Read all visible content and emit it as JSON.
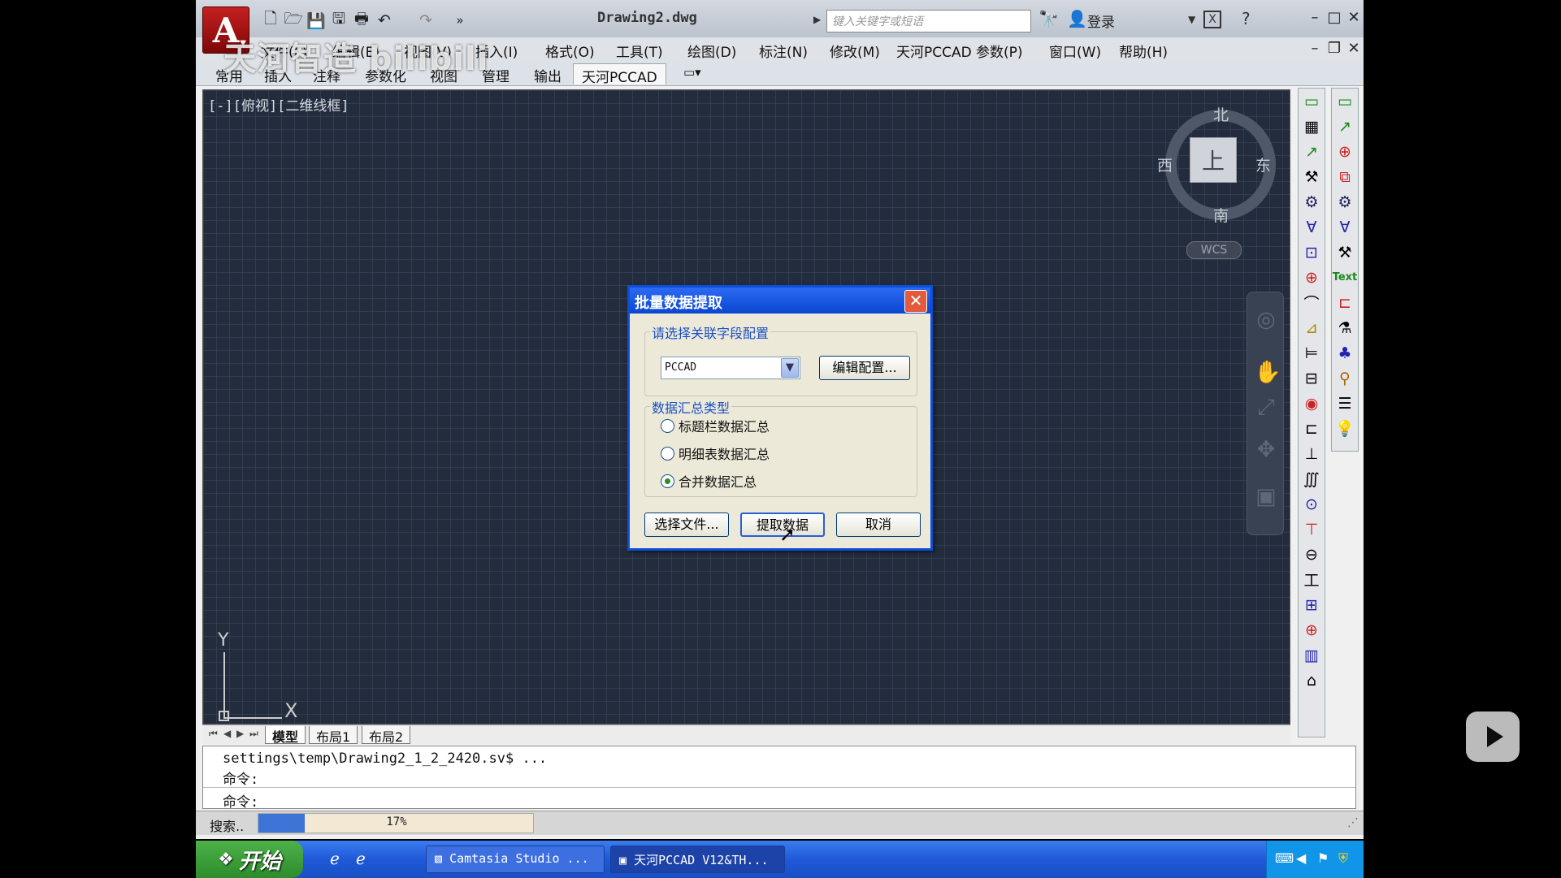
{
  "window": {
    "doc_title": "Drawing2.dwg",
    "search_placeholder": "键入关键字或短语",
    "login": "登录",
    "logo_letter": "A"
  },
  "watermark": "天河智造 bilibili",
  "menu": [
    "文件(F)",
    "编辑(E)",
    "视图(V)",
    "插入(I)",
    "格式(O)",
    "工具(T)",
    "绘图(D)",
    "标注(N)",
    "修改(M)",
    "天河PCCAD",
    "参数(P)",
    "窗口(W)",
    "帮助(H)"
  ],
  "ribbon_tabs": [
    "常用",
    "插入",
    "注释",
    "参数化",
    "视图",
    "管理",
    "输出",
    "天河PCCAD"
  ],
  "ribbon_active": "天河PCCAD",
  "canvas": {
    "view_label": "[-][俯视][二维线框]",
    "viewcube_face": "上",
    "north": "北",
    "south": "南",
    "east": "东",
    "west": "西",
    "wcs": "WCS",
    "ucs_x": "X",
    "ucs_y": "Y"
  },
  "layout_tabs": [
    "模型",
    "布局1",
    "布局2"
  ],
  "command": {
    "line1": "settings\\temp\\Drawing2_1_2_2420.sv$ ...",
    "line2": "命令:",
    "line3": "命令:"
  },
  "status": {
    "label": "搜索..",
    "progress_text": "17%",
    "progress": 0.17
  },
  "dialog": {
    "title": "批量数据提取",
    "group1_title": "请选择关联字段配置",
    "combo_value": "PCCAD",
    "edit_config": "编辑配置...",
    "group2_title": "数据汇总类型",
    "radios": [
      "标题栏数据汇总",
      "明细表数据汇总",
      "合并数据汇总"
    ],
    "selected_radio": 2,
    "select_file": "选择文件...",
    "extract": "提取数据",
    "cancel": "取消"
  },
  "taskbar": {
    "start": "开始",
    "task1": "Camtasia Studio ...",
    "task2": "天河PCCAD V12&TH..."
  },
  "colors": {
    "canvas_bg": "#232c3c",
    "dialog_title": "#0a46cf",
    "taskbar": "#1f59d8",
    "start": "#2d8c2c"
  }
}
